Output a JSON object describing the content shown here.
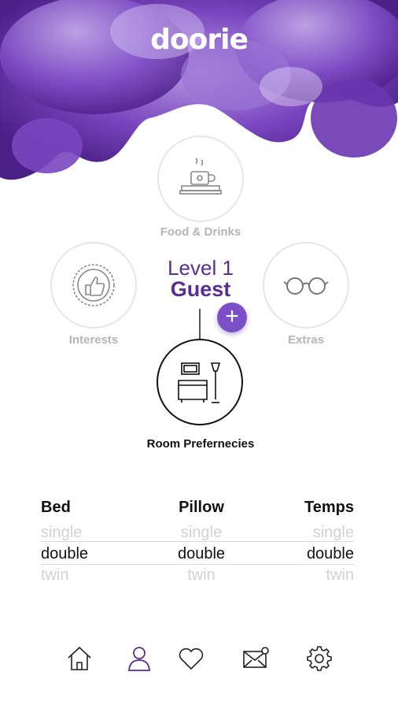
{
  "app": {
    "logo": "doorie"
  },
  "categories": {
    "food": {
      "label": "Food & Drinks",
      "icon": "coffee-cup-icon"
    },
    "interests": {
      "label": "Interests",
      "icon": "thumbs-up-badge-icon"
    },
    "extras": {
      "label": "Extras",
      "icon": "glasses-icon"
    },
    "room": {
      "label": "Room Prefernecies",
      "icon": "room-furniture-icon"
    }
  },
  "level": {
    "title": "Level 1",
    "name": "Guest",
    "add_label": "+"
  },
  "preferences": {
    "bed": {
      "header": "Bed",
      "options": [
        "single",
        "double",
        "twin"
      ],
      "selected": "double"
    },
    "pillow": {
      "header": "Pillow",
      "options": [
        "single",
        "double",
        "twin"
      ],
      "selected": "double"
    },
    "temps": {
      "header": "Temps",
      "options": [
        "single",
        "double",
        "twin"
      ],
      "selected": "double"
    }
  },
  "nav": {
    "items": [
      {
        "name": "home",
        "icon": "home-icon"
      },
      {
        "name": "profile",
        "icon": "user-icon",
        "active": true
      },
      {
        "name": "favorites",
        "icon": "heart-icon"
      },
      {
        "name": "messages",
        "icon": "mail-icon"
      },
      {
        "name": "settings",
        "icon": "gear-icon"
      }
    ]
  },
  "colors": {
    "accent": "#5a2d91",
    "button": "#7b4fc7"
  }
}
